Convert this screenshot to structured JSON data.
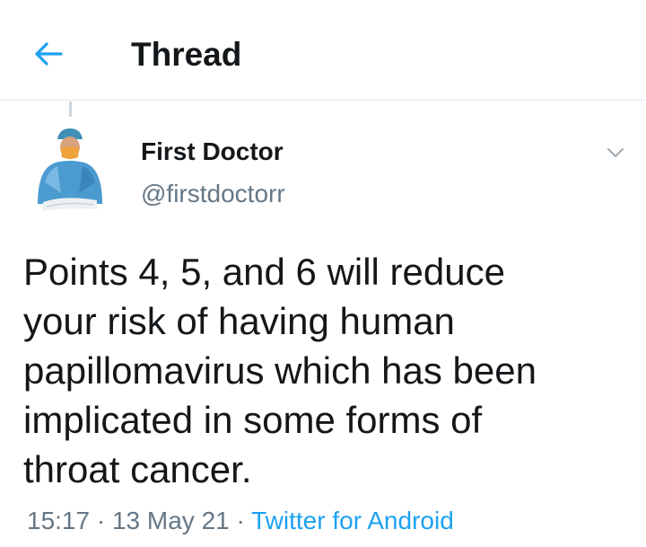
{
  "header": {
    "back_icon": "arrow-left-icon",
    "title": "Thread",
    "accent_color": "#1da1f2"
  },
  "tweet": {
    "author": {
      "display_name": "First Doctor",
      "handle": "@firstdoctorr",
      "avatar": "doctor-in-scrubs-avatar"
    },
    "menu_icon": "chevron-down-icon",
    "text": "Points 4, 5, and 6 will reduce\nyour risk of having human\npapillomavirus which has been\nimplicated in some forms of\nthroat cancer.",
    "time": "15:17",
    "separator": " · ",
    "date": "13 May 21",
    "source": "Twitter for Android"
  }
}
